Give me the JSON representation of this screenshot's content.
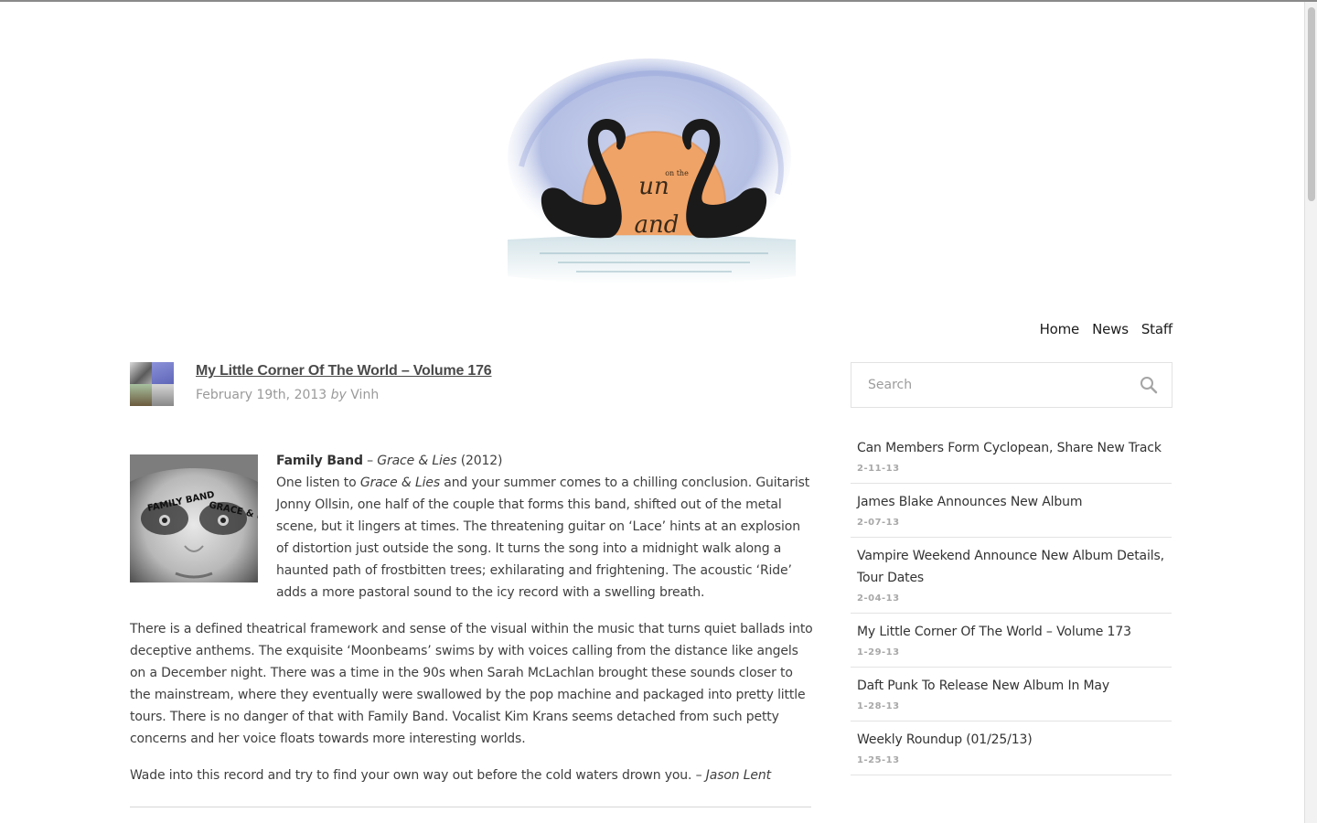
{
  "site": {
    "logo": {
      "icon": "swans-sunset-logo",
      "text": "Sun on the Sand",
      "colors": {
        "sun": "#f0a366",
        "swan": "#1a1a1a",
        "wash": "#a7b4dd"
      }
    }
  },
  "nav": {
    "items": [
      {
        "label": "Home"
      },
      {
        "label": "News"
      },
      {
        "label": "Staff"
      }
    ]
  },
  "post": {
    "thumbnail_icon": "post-collage-thumbnail",
    "title": "My Little Corner Of The World – Volume 176",
    "date": "February 19th, 2013",
    "by": "by",
    "author": "Vinh",
    "album_art_icon": "family-band-grace-and-lies-cover",
    "album_art_text": {
      "left": "FAMILY BAND",
      "right": "GRACE & LIES"
    },
    "entry": {
      "artist": "Family Band",
      "dash": " – ",
      "album": "Grace & Lies",
      "year": " (2012)",
      "p1_a": "One listen to ",
      "p1_album": "Grace & Lies",
      "p1_b": " and your summer comes to a chilling conclusion. Guitarist Jonny Ollsin, one half of the couple that forms this band, shifted out of the metal scene, but it lingers at times. The threatening guitar on ‘Lace’ hints at an explosion of distortion just outside the song. It turns the song into a midnight walk along a haunted path of frostbitten trees; exhilarating and frightening. The acoustic ‘Ride’ adds a more pastoral sound to the icy record with a swelling breath.",
      "p2": "There is a defined theatrical framework and sense of the visual within the music that turns quiet ballads into deceptive anthems. The exquisite ‘Moonbeams’ swims by with voices calling from the distance like angels on a December night. There was a time in the 90s when Sarah McLachlan brought these sounds closer to the mainstream, where they eventually were swallowed by the pop machine and packaged into pretty little tours. There is no danger of that with Family Band. Vocalist Kim Krans seems detached from such petty concerns and her voice floats towards more interesting worlds.",
      "p3": "Wade into this record and try to find your own way out before the cold waters drown you. – ",
      "p3_author": "Jason Lent"
    }
  },
  "sidebar": {
    "search": {
      "placeholder": "Search",
      "value": "",
      "icon": "search-icon"
    },
    "news": [
      {
        "title": "Can Members Form Cyclopean, Share New Track",
        "date": "2-11-13"
      },
      {
        "title": "James Blake Announces New Album",
        "date": "2-07-13"
      },
      {
        "title": "Vampire Weekend Announce New Album Details, Tour Dates",
        "date": "2-04-13"
      },
      {
        "title": "My Little Corner Of The World – Volume 173",
        "date": "1-29-13"
      },
      {
        "title": "Daft Punk To Release New Album In May",
        "date": "1-28-13"
      },
      {
        "title": "Weekly Roundup (01/25/13)",
        "date": "1-25-13"
      }
    ]
  }
}
